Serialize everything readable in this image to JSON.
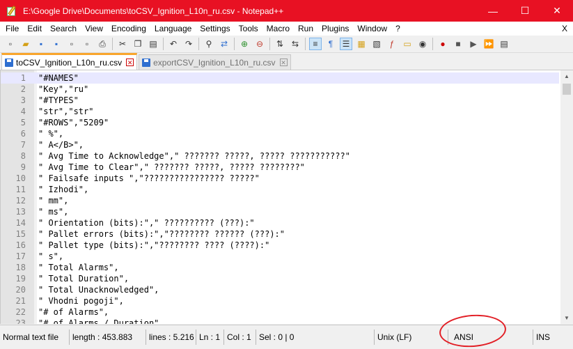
{
  "window": {
    "title": "E:\\Google Drive\\Documents\\toCSV_Ignition_L10n_ru.csv - Notepad++",
    "minimize": "—",
    "maximize": "☐",
    "close": "✕"
  },
  "menu": {
    "items": [
      "File",
      "Edit",
      "Search",
      "View",
      "Encoding",
      "Language",
      "Settings",
      "Tools",
      "Macro",
      "Run",
      "Plugins",
      "Window",
      "?"
    ],
    "close": "X"
  },
  "toolbar": {
    "icons": [
      "new-file",
      "open-file",
      "save",
      "save-all",
      "close",
      "close-all",
      "print",
      "cut",
      "copy",
      "paste",
      "undo",
      "redo",
      "find",
      "replace",
      "zoom-in",
      "zoom-out",
      "sync-vertical",
      "sync-horizontal",
      "word-wrap",
      "show-all-chars",
      "indent-guide",
      "user-defined-lang",
      "doc-map",
      "function-list",
      "folder-as-workspace",
      "monitor",
      "record-macro",
      "stop-record",
      "play-macro",
      "run-macro-multiple",
      "save-macro"
    ]
  },
  "tabs": [
    {
      "label": "toCSV_Ignition_L10n_ru.csv",
      "active": true
    },
    {
      "label": "exportCSV_Ignition_L10n_ru.csv",
      "active": false
    }
  ],
  "editor": {
    "lines": [
      {
        "n": "1",
        "text": "\"#NAMES\""
      },
      {
        "n": "2",
        "text": "\"Key\",\"ru\""
      },
      {
        "n": "3",
        "text": "\"#TYPES\""
      },
      {
        "n": "4",
        "text": "\"str\",\"str\""
      },
      {
        "n": "5",
        "text": "\"#ROWS\",\"5209\""
      },
      {
        "n": "6",
        "text": "\" %\","
      },
      {
        "n": "7",
        "text": "\" A</B>\","
      },
      {
        "n": "8",
        "text": "\" Avg Time to Acknowledge\",\" ??????? ?????, ????? ???????????\""
      },
      {
        "n": "9",
        "text": "\" Avg Time to Clear\",\" ??????? ?????, ????? ????????\""
      },
      {
        "n": "10",
        "text": "\" Failsafe inputs \",\"???????????????? ?????\""
      },
      {
        "n": "11",
        "text": "\" Izhodi\","
      },
      {
        "n": "12",
        "text": "\" mm\","
      },
      {
        "n": "13",
        "text": "\" ms\","
      },
      {
        "n": "14",
        "text": "\" Orientation (bits):\",\" ?????????? (???):\""
      },
      {
        "n": "15",
        "text": "\" Pallet errors (bits):\",\"???????? ?????? (???):\""
      },
      {
        "n": "16",
        "text": "\" Pallet type (bits):\",\"???????? ???? (????):\""
      },
      {
        "n": "17",
        "text": "\" s\","
      },
      {
        "n": "18",
        "text": "\" Total Alarms\","
      },
      {
        "n": "19",
        "text": "\" Total Duration\","
      },
      {
        "n": "20",
        "text": "\" Total Unacknowledged\","
      },
      {
        "n": "21",
        "text": "\" Vhodni pogoji\","
      },
      {
        "n": "22",
        "text": "\"# of Alarms\","
      },
      {
        "n": "23",
        "text": "\"# of Alarms / Duration\","
      }
    ]
  },
  "status": {
    "type": "Normal text file",
    "length": "length : 453.883",
    "lines": "lines : 5.216",
    "ln": "Ln : 1",
    "col": "Col : 1",
    "sel": "Sel : 0 | 0",
    "eol": "Unix (LF)",
    "encoding": "ANSI",
    "mode": "INS"
  }
}
